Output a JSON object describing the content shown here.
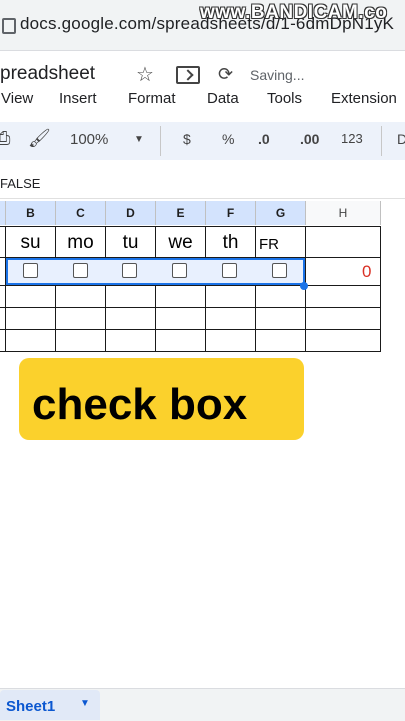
{
  "browser": {
    "url": "docs.google.com/spreadsheets/d/1-6dmDpN1yK",
    "watermark": "www.BANDICAM.co"
  },
  "doc": {
    "title": "preadsheet",
    "status": "Saving..."
  },
  "menu": [
    "View",
    "Insert",
    "Format",
    "Data",
    "Tools",
    "Extension"
  ],
  "toolbar": {
    "zoom": "100%",
    "currency": "$",
    "percent": "%",
    "dec_decrease": ".0",
    "dec_increase": ".00",
    "format_123": "123"
  },
  "formula_bar": {
    "value": "FALSE"
  },
  "grid": {
    "columns": [
      "B",
      "C",
      "D",
      "E",
      "F",
      "G",
      "H"
    ],
    "days": [
      "su",
      "mo",
      "tu",
      "we",
      "th",
      "FR"
    ],
    "count_value": "0"
  },
  "caption": "check box",
  "sheets": {
    "active": "Sheet1"
  }
}
